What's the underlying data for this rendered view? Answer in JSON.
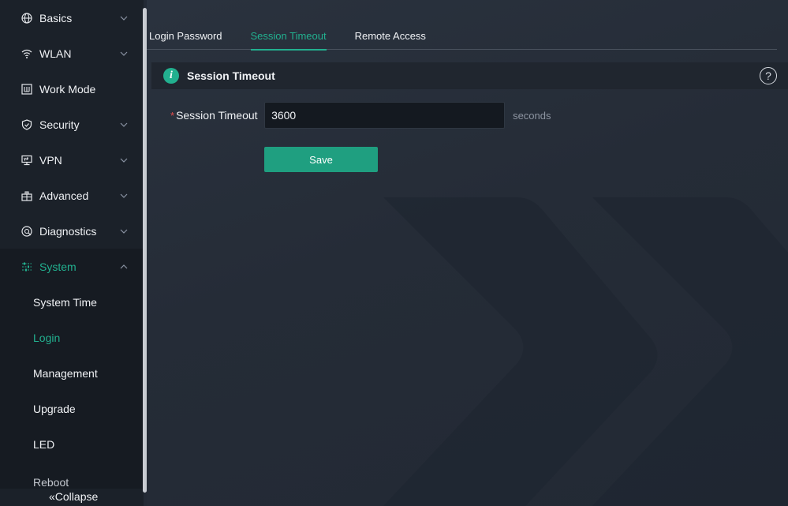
{
  "sidebar": {
    "items": [
      {
        "label": "Basics",
        "icon": "globe-icon",
        "chevron": true
      },
      {
        "label": "WLAN",
        "icon": "wifi-icon",
        "chevron": true
      },
      {
        "label": "Work Mode",
        "icon": "work-mode-icon",
        "chevron": false
      },
      {
        "label": "Security",
        "icon": "shield-icon",
        "chevron": true
      },
      {
        "label": "VPN",
        "icon": "vpn-icon",
        "chevron": true
      },
      {
        "label": "Advanced",
        "icon": "advanced-icon",
        "chevron": true
      },
      {
        "label": "Diagnostics",
        "icon": "diagnostics-icon",
        "chevron": true
      },
      {
        "label": "System",
        "icon": "sliders-icon",
        "chevron": true,
        "open": true
      }
    ],
    "sub_items": [
      {
        "label": "System Time"
      },
      {
        "label": "Login",
        "active": true
      },
      {
        "label": "Management"
      },
      {
        "label": "Upgrade"
      },
      {
        "label": "LED"
      },
      {
        "label": "Reboot"
      }
    ],
    "collapse_label": "«Collapse"
  },
  "tabs": [
    {
      "label": "Login Password"
    },
    {
      "label": "Session Timeout",
      "active": true
    },
    {
      "label": "Remote Access"
    }
  ],
  "section": {
    "title": "Session Timeout",
    "info_icon_glyph": "i",
    "help_icon_glyph": "?"
  },
  "form": {
    "required_mark": "*",
    "label": "Session Timeout",
    "value": "3600",
    "unit": "seconds",
    "save_label": "Save"
  },
  "colors": {
    "accent": "#22b08f",
    "button": "#1f9f80",
    "required": "#e24c4c"
  }
}
